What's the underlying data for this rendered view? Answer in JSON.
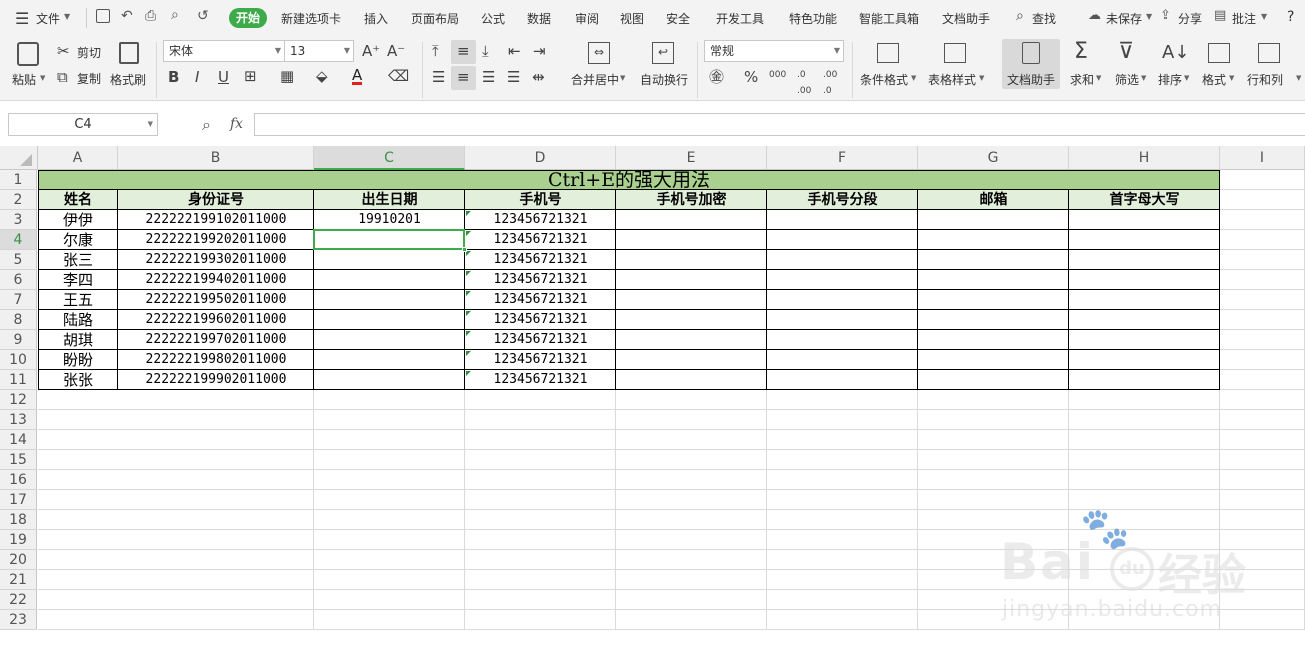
{
  "menubar": {
    "file_label": "文件",
    "tabs": [
      "开始",
      "新建选项卡",
      "插入",
      "页面布局",
      "公式",
      "数据",
      "审阅",
      "视图",
      "安全",
      "开发工具",
      "特色功能",
      "智能工具箱",
      "文档助手"
    ],
    "active_tab": "开始",
    "search_label": "查找",
    "unsaved_label": "未保存",
    "share_label": "分享",
    "comment_label": "批注",
    "help_label": "?"
  },
  "ribbon": {
    "paste_label": "粘贴",
    "cut_label": "剪切",
    "copy_label": "复制",
    "format_painter_label": "格式刷",
    "font_name": "宋体",
    "font_size": "13",
    "merge_center_label": "合并居中",
    "wrap_text_label": "自动换行",
    "number_format": "常规",
    "conditional_format_label": "条件格式",
    "table_style_label": "表格样式",
    "doc_assistant_label": "文档助手",
    "sum_label": "求和",
    "filter_label": "筛选",
    "sort_label": "排序",
    "format_label": "格式",
    "row_col_label": "行和列"
  },
  "formula_bar": {
    "name_box": "C4",
    "fx_label": "fx",
    "content": ""
  },
  "sheet": {
    "columns": [
      "A",
      "B",
      "C",
      "D",
      "E",
      "F",
      "G",
      "H",
      "I"
    ],
    "selected_column": "C",
    "rows": [
      "1",
      "2",
      "3",
      "4",
      "5",
      "6",
      "7",
      "8",
      "9",
      "10",
      "11",
      "12",
      "13",
      "14",
      "15",
      "16",
      "17",
      "18",
      "19",
      "20",
      "21",
      "22",
      "23"
    ],
    "selected_row": "4",
    "title": "Ctrl+E的强大用法",
    "title_bg": "#a9d08e",
    "header_bg": "#e2efda",
    "headers": [
      "姓名",
      "身份证号",
      "出生日期",
      "手机号",
      "手机号加密",
      "手机号分段",
      "邮箱",
      "首字母大写"
    ],
    "data": [
      [
        "伊伊",
        "222222199102011000",
        "19910201",
        "123456721321"
      ],
      [
        "尔康",
        "222222199202011000",
        "",
        "123456721321"
      ],
      [
        "张三",
        "222222199302011000",
        "",
        "123456721321"
      ],
      [
        "李四",
        "222222199402011000",
        "",
        "123456721321"
      ],
      [
        "王五",
        "222222199502011000",
        "",
        "123456721321"
      ],
      [
        "陆路",
        "222222199602011000",
        "",
        "123456721321"
      ],
      [
        "胡琪",
        "222222199702011000",
        "",
        "123456721321"
      ],
      [
        "盼盼",
        "222222199802011000",
        "",
        "123456721321"
      ],
      [
        "张张",
        "222222199902011000",
        "",
        "123456721321"
      ]
    ]
  },
  "watermark": {
    "brand": "Bai",
    "brand_cn": "经验",
    "url": "jingyan.baidu.com"
  },
  "colors": {
    "accent": "#3dab4a",
    "selection": "#3dab4a"
  }
}
